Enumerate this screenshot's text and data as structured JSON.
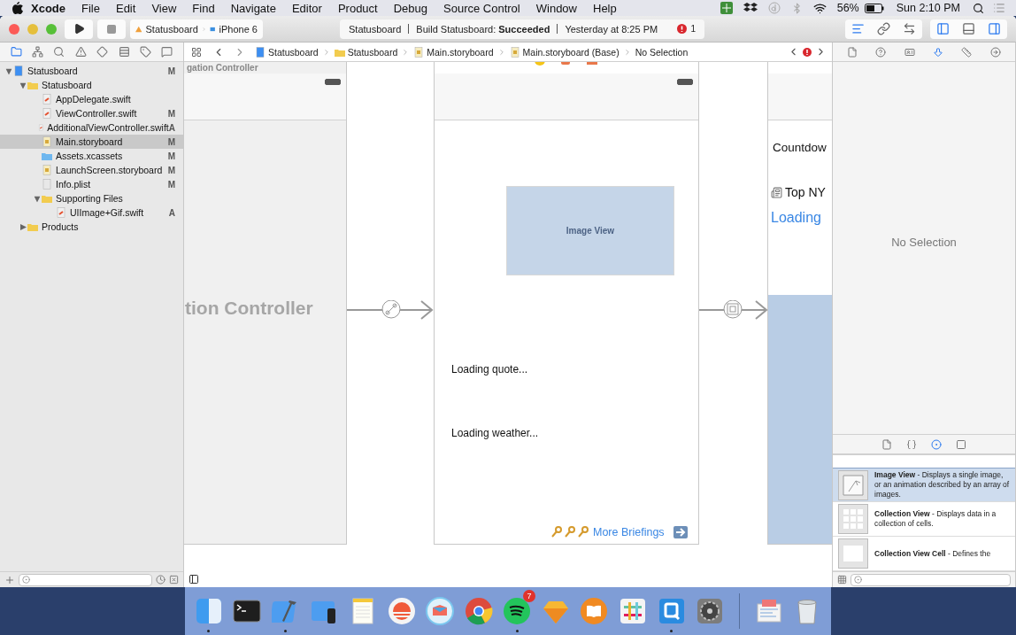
{
  "menubar": {
    "app": "Xcode",
    "menus": [
      "File",
      "Edit",
      "View",
      "Find",
      "Navigate",
      "Editor",
      "Product",
      "Debug",
      "Source Control",
      "Window",
      "Help"
    ],
    "battery": "56%",
    "clock": "Sun 2:10 PM"
  },
  "toolbar": {
    "scheme": "Statusboard",
    "device": "iPhone 6",
    "activity": {
      "project": "Statusboard",
      "status": "Build Statusboard: **Succeeded**",
      "time": "Yesterday at 8:25 PM",
      "errors": "1"
    },
    "editor_modes": [
      {
        "selected": true
      },
      {
        "selected": false
      },
      {
        "selected": false
      }
    ],
    "panels": [
      {
        "on": true
      },
      {
        "on": false
      },
      {
        "on": true
      }
    ]
  },
  "navigator": {
    "tabs": [
      {
        "selected": true
      },
      {
        "selected": false
      },
      {
        "selected": false
      },
      {
        "selected": false
      },
      {
        "selected": false
      },
      {
        "selected": false
      },
      {
        "selected": false
      },
      {
        "selected": false
      }
    ],
    "tree": [
      {
        "label": "Statusboard",
        "kind": "project",
        "badge": "M",
        "expanded": true,
        "selected": false,
        "children": [
          {
            "label": "Statusboard",
            "kind": "folder",
            "expanded": true,
            "selected": false,
            "children": [
              {
                "label": "AppDelegate.swift",
                "kind": "swift",
                "selected": false
              },
              {
                "label": "ViewController.swift",
                "kind": "swift",
                "badge": "M",
                "selected": false
              },
              {
                "label": "AdditionalViewController.swift",
                "kind": "swift",
                "badge": "A",
                "selected": false
              },
              {
                "label": "Main.storyboard",
                "kind": "storyboard",
                "badge": "M",
                "selected": true
              },
              {
                "label": "Assets.xcassets",
                "kind": "assets",
                "badge": "M",
                "selected": false
              },
              {
                "label": "LaunchScreen.storyboard",
                "kind": "storyboard",
                "badge": "M",
                "selected": false
              },
              {
                "label": "Info.plist",
                "kind": "plist",
                "badge": "M",
                "selected": false
              },
              {
                "label": "Supporting Files",
                "kind": "folder",
                "expanded": true,
                "selected": false,
                "children": [
                  {
                    "label": "UIImage+Gif.swift",
                    "kind": "swift",
                    "badge": "A",
                    "selected": false
                  }
                ]
              }
            ]
          },
          {
            "label": "Products",
            "kind": "folder",
            "expanded": false,
            "selected": false
          }
        ]
      }
    ]
  },
  "jump_bar": [
    {
      "kind": "project",
      "label": "Statusboard"
    },
    {
      "kind": "folder",
      "label": "Statusboard"
    },
    {
      "kind": "storyboard",
      "label": "Main.storyboard"
    },
    {
      "kind": "storyboard",
      "label": "Main.storyboard (Base)"
    },
    {
      "kind": "none",
      "label": "No Selection"
    }
  ],
  "canvas": {
    "scenes": [
      {
        "kind": "navigation",
        "top_title": "gation Controller",
        "title": "tion Controller"
      },
      {
        "kind": "view",
        "image_label": "Image View",
        "labels": [
          "Loading quote...",
          "Loading weather..."
        ],
        "link": "More Briefings"
      },
      {
        "kind": "detail",
        "label": "Countdow",
        "headline": "Top NY",
        "loading": "Loading"
      }
    ],
    "segues": [
      {
        "kind": "root"
      },
      {
        "kind": "show"
      }
    ]
  },
  "inspector": {
    "tabs": [
      {
        "selected": false
      },
      {
        "selected": false
      },
      {
        "selected": false
      },
      {
        "selected": true
      },
      {
        "selected": false
      },
      {
        "selected": false
      }
    ],
    "empty": "No Selection"
  },
  "library": {
    "tabs": [
      {
        "selected": false
      },
      {
        "selected": false
      },
      {
        "selected": true
      },
      {
        "selected": false
      }
    ],
    "items": [
      {
        "kind": "image",
        "text": "**Image View** - Displays a single image, or an animation described by an array of images.",
        "selected": true
      },
      {
        "kind": "collection",
        "text": "**Collection View** - Displays data in a collection of cells.",
        "selected": false
      },
      {
        "kind": "cell",
        "text": "**Collection View Cell** - Defines the",
        "selected": false
      }
    ]
  },
  "dock": [
    {
      "kind": "finder",
      "running": true
    },
    {
      "kind": "terminal",
      "running": false
    },
    {
      "kind": "xcode",
      "running": true
    },
    {
      "kind": "simulator",
      "running": false
    },
    {
      "kind": "notes",
      "running": false
    },
    {
      "kind": "sunrise",
      "running": false
    },
    {
      "kind": "airmail",
      "running": false
    },
    {
      "kind": "chrome",
      "running": false
    },
    {
      "kind": "spotify",
      "running": true,
      "badge": "7"
    },
    {
      "kind": "sketch",
      "running": false
    },
    {
      "kind": "books",
      "running": false
    },
    {
      "kind": "slack",
      "running": false
    },
    {
      "kind": "quicklook",
      "running": true
    },
    {
      "kind": "settings",
      "running": false
    },
    {
      "kind": "separator"
    },
    {
      "kind": "preview",
      "running": false
    },
    {
      "kind": "trash",
      "running": false
    }
  ]
}
